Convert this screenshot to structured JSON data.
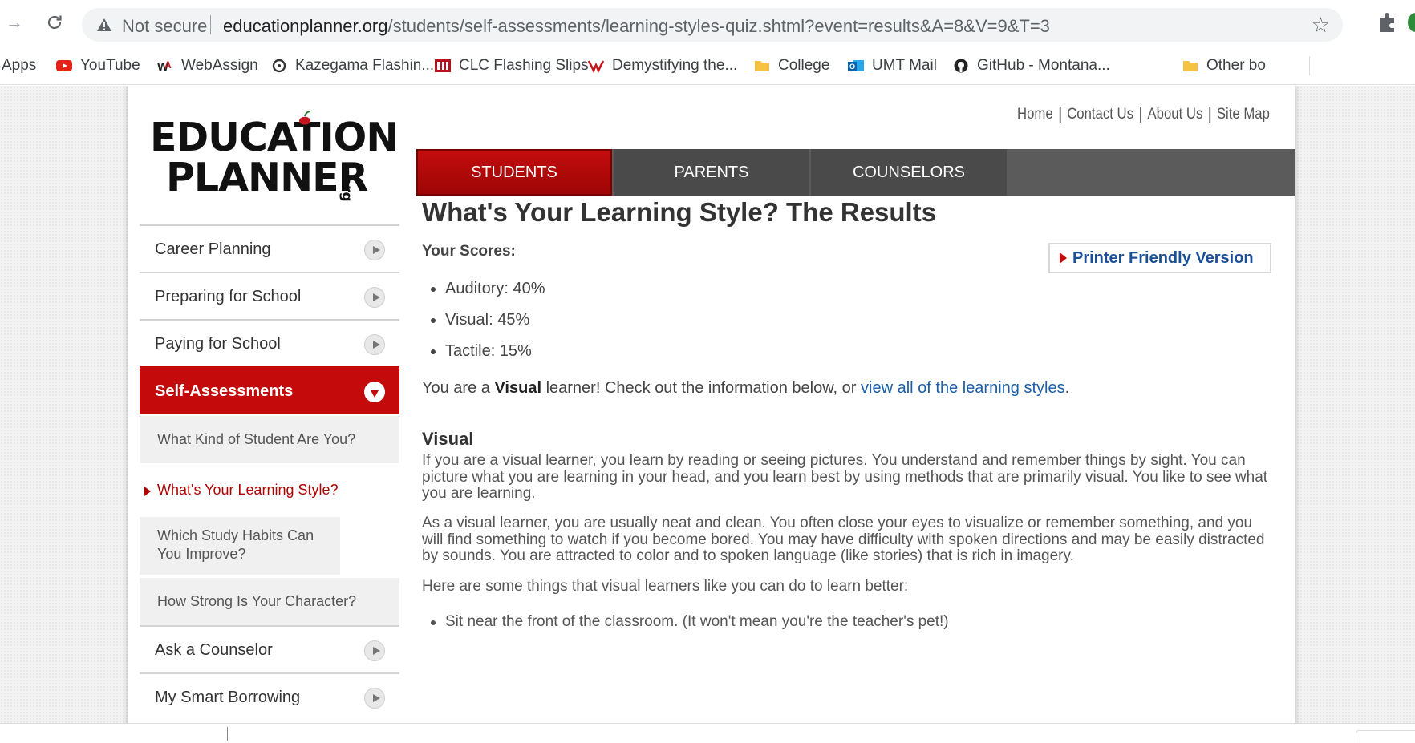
{
  "browser": {
    "address_bar": {
      "security_label": "Not secure",
      "url_host": "educationplanner.org",
      "url_path": "/students/self-assessments/learning-styles-quiz.shtml?event=results&A=8&V=9&T=3"
    },
    "bookmarks": [
      {
        "label": "Apps",
        "icon": "apps-grid-icon"
      },
      {
        "label": "YouTube",
        "icon": "youtube-icon"
      },
      {
        "label": "WebAssign",
        "icon": "webassign-icon"
      },
      {
        "label": "Kazegama Flashin...",
        "icon": "kazegama-icon"
      },
      {
        "label": "CLC Flashing Slips",
        "icon": "clc-icon"
      },
      {
        "label": "Demystifying the...",
        "icon": "demystifying-icon"
      },
      {
        "label": "College",
        "icon": "folder-icon"
      },
      {
        "label": "UMT Mail",
        "icon": "outlook-icon"
      },
      {
        "label": "GitHub - Montana...",
        "icon": "github-icon"
      },
      {
        "label": "Other bo",
        "icon": "folder-icon"
      }
    ]
  },
  "site": {
    "logo": {
      "line1": "EDUCATION",
      "line2": "PLANNER",
      "suffix": ".org"
    },
    "utility_nav": [
      "Home",
      "Contact Us",
      "About Us",
      "Site Map"
    ],
    "main_nav": [
      "STUDENTS",
      "PARENTS",
      "COUNSELORS"
    ],
    "main_nav_active": "STUDENTS",
    "colors": {
      "brand_red": "#c40a0a",
      "nav_gray": "#4a4a4a",
      "link_blue": "#1a5fa8"
    },
    "sidebar": {
      "items": [
        {
          "label": "Career Planning"
        },
        {
          "label": "Preparing for School"
        },
        {
          "label": "Paying for School"
        },
        {
          "label": "Self-Assessments",
          "active": true
        },
        {
          "label": "Ask a Counselor"
        },
        {
          "label": "My Smart Borrowing"
        }
      ],
      "sub_items": [
        {
          "label": "What Kind of Student Are You?"
        },
        {
          "label": "What's Your Learning Style?",
          "current": true
        },
        {
          "label": "Which Study Habits Can You Improve?"
        },
        {
          "label": "How Strong Is Your Character?"
        }
      ]
    },
    "content": {
      "title": "What's Your Learning Style? The Results",
      "scores_label": "Your Scores:",
      "printer_button": "Printer Friendly Version",
      "scores": [
        {
          "label": "Auditory",
          "percent": 40,
          "text": "Auditory: 40%"
        },
        {
          "label": "Visual",
          "percent": 45,
          "text": "Visual: 45%"
        },
        {
          "label": "Tactile",
          "percent": 15,
          "text": "Tactile: 15%"
        }
      ],
      "summary": {
        "prefix": "You are a ",
        "style": "Visual",
        "middle": " learner! Check out the information below, or ",
        "link": "view all of the learning styles",
        "suffix": "."
      },
      "section_heading": "Visual",
      "paragraphs": [
        "If you are a visual learner, you learn by reading or seeing pictures. You understand and remember things by sight. You can picture what you are learning in your head, and you learn best by using methods that are primarily visual. You like to see what you are learning.",
        "As a visual learner, you are usually neat and clean. You often close your eyes to visualize or remember something, and you will find something to watch if you become bored. You may have difficulty with spoken directions and may be easily distracted by sounds. You are attracted to color and to spoken language (like stories) that is rich in imagery.",
        "Here are some things that visual learners like you can do to learn better:"
      ],
      "tips": [
        "Sit near the front of the classroom. (It won't mean you're the teacher's pet!)"
      ]
    }
  }
}
